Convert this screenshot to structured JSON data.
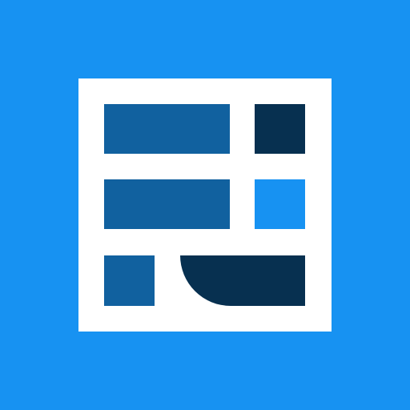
{
  "icon": {
    "name": "spreadsheet-table-icon",
    "colors": {
      "background": "#1792F2",
      "frame": "#FFFFFF",
      "medium_blue": "#11619F",
      "dark_navy": "#073050",
      "bright_blue": "#1792F2"
    }
  }
}
